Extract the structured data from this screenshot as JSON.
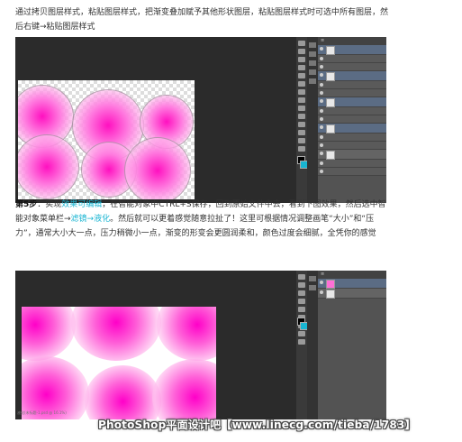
{
  "para1": {
    "text": "通过拷贝图层样式，粘贴图层样式，把渐变叠加赋予其他形状图层，粘贴图层样式时可选中所有图层，然后右键→粘贴图层样式"
  },
  "para2": {
    "step_label": "第5步",
    "part1": "：实现",
    "highlight1": "效果可编辑",
    "part2": "，在智能对象中CTRL+S保存，回到原始文件中去，看到下图效果，然后选中智能对象菜单栏→",
    "highlight2": "滤镜→液化",
    "part3": "。然后就可以更着感觉随意拉扯了！这里可根据情况调整画笔“大小”和“压力”，通常大小大一点，压力稍微小一点，渐变的形变会更圆润柔和，颜色过度会细腻，全凭你的感觉"
  },
  "caption": "液化(未标题-1.psd @ 16.1%)",
  "watermark": "PhotoShop平面设计吧【www.linecg.com/tieba/1783】",
  "colors": {
    "magenta": "#ff1ec8",
    "cyan_accent": "#19b5d2",
    "ps_dark": "#2b2b2b",
    "panel_gray": "#535353",
    "selected_layer": "#5b6c84"
  }
}
